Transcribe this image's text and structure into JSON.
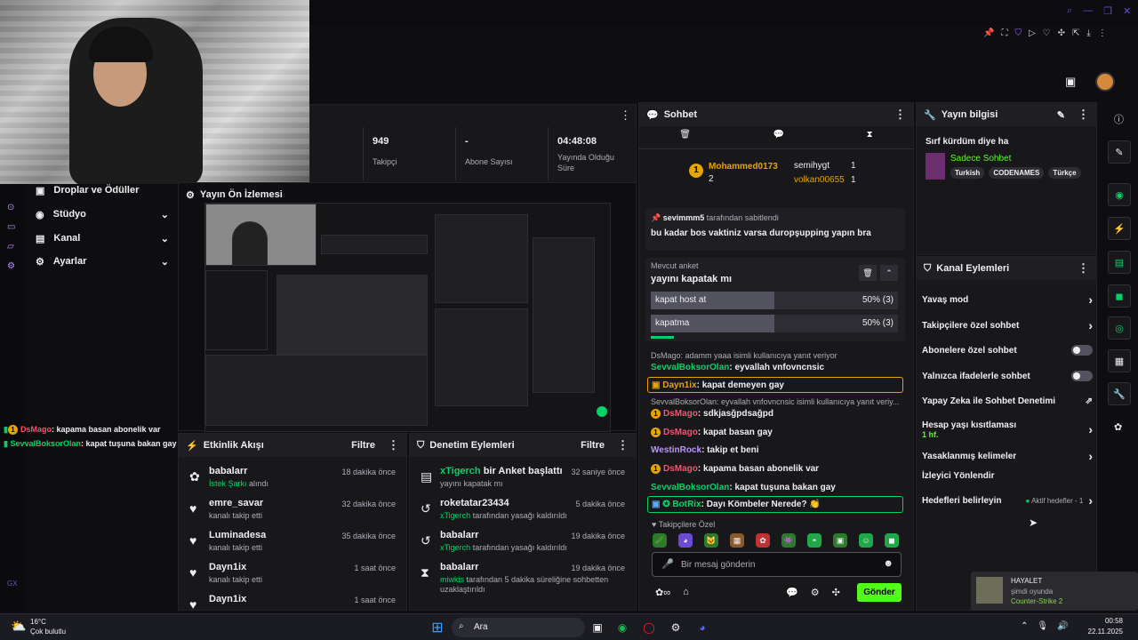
{
  "topbar": {
    "icons": [
      "search-icon",
      "minimize-icon",
      "maximize-icon",
      "close-icon"
    ]
  },
  "toolbar": {
    "icons": [
      "pin-icon",
      "crop-icon",
      "shield-icon",
      "play-icon",
      "heart-icon",
      "puzzle-icon",
      "share-icon",
      "download-icon",
      "settings-icon"
    ]
  },
  "stats": {
    "followers": "949",
    "followers_label": "Takipçi",
    "subs": "-",
    "subs_label": "Abone Sayısı",
    "uptime": "04:48:08",
    "uptime_label": "Yayında Olduğu Süre"
  },
  "sidebar": {
    "items": [
      {
        "label": "Droplar ve Ödüller"
      },
      {
        "label": "Stüdyo"
      },
      {
        "label": "Kanal"
      },
      {
        "label": "Ayarlar"
      }
    ],
    "gx": "GX"
  },
  "overlay_chat": [
    {
      "user": "DsMago",
      "text": ": kapama basan abonelik var"
    },
    {
      "user": "SevvalBoksorOlan",
      "text": ": kapat tuşuna bakan gay"
    }
  ],
  "preview": {
    "title": "Yayın Ön İzlemesi"
  },
  "activity": {
    "title": "Etkinlik Akışı",
    "filter": "Filtre",
    "rows": [
      {
        "name": "babalarr",
        "sub_hl": "İstek Şarkı",
        "sub": " alındı",
        "time": "18 dakika önce",
        "icon": "gift-icon"
      },
      {
        "name": "emre_savar",
        "sub": "kanalı takip etti",
        "time": "32 dakika önce",
        "icon": "heart-icon"
      },
      {
        "name": "Luminadesa",
        "sub": "kanalı takip etti",
        "time": "35 dakika önce",
        "icon": "heart-icon"
      },
      {
        "name": "Dayn1ix",
        "sub": "kanalı takip etti",
        "time": "1 saat önce",
        "icon": "heart-icon"
      },
      {
        "name": "Dayn1ix",
        "sub": "",
        "time": "1 saat önce",
        "icon": "heart-icon"
      }
    ]
  },
  "moderation": {
    "title": "Denetim Eylemleri",
    "filter": "Filtre",
    "rows": [
      {
        "name": "xTigerch",
        "name_tail": " bir Anket başlattı",
        "sub": "yayını kapatak mı",
        "time": "32 saniye önce"
      },
      {
        "name": "roketatar23434",
        "sub_hl": "xTigerch",
        "sub": " tarafından yasağı kaldırıldı",
        "time": "5 dakika önce"
      },
      {
        "name": "babalarr",
        "sub_hl": "xTigerch",
        "sub": " tarafından yasağı kaldırıldı",
        "time": "19 dakika önce"
      },
      {
        "name": "babalarr",
        "sub_hl": "miwkis",
        "sub": " tarafından 5 dakika süreliğine sohbetten uzaklaştırıldı",
        "time": "19 dakika önce"
      }
    ]
  },
  "chat": {
    "title": "Sohbet",
    "leaders": [
      {
        "rank": "1",
        "name": "Mohammed0173",
        "count": "2"
      },
      {
        "name": "semihygt",
        "count": "1"
      },
      {
        "name": "volkan00655",
        "count": "1"
      }
    ],
    "pinned_by_user": "sevimmm5",
    "pinned_by_label": " tarafından sabitlendi",
    "pinned_text": "bu kadar bos vaktiniz varsa duropşupping yapın bra",
    "poll_label": "Mevcut anket",
    "poll_title": "yayını kapatak mı",
    "poll_options": [
      {
        "label": "kapat host at",
        "pct": "50% (3)",
        "value": 50
      },
      {
        "label": "kapatma",
        "pct": "50% (3)",
        "value": 50
      }
    ],
    "messages": [
      {
        "reply": "DsMago: adamm yaaa isimli kullanıcıya yanıt veriyor"
      },
      {
        "user": "SevvalBoksorOlan",
        "text": ": eyvallah vnfovncnsic",
        "color": "#00d26a"
      },
      {
        "user": "Dayn1ix",
        "text": ": kapat demeyen gay",
        "color": "#e5a400",
        "hl": true
      },
      {
        "reply": "SevvalBoksorOlan: eyvallah vnfovncnsic isimli kullanıcıya yanıt veriy..."
      },
      {
        "user": "DsMago",
        "text": ": sdkjasğpdsağpd",
        "color": "#ff4d6d",
        "badge": true
      },
      {
        "user": "DsMago",
        "text": ": kapat basan gay",
        "color": "#ff4d6d",
        "badge": true
      },
      {
        "user": "WestinRock",
        "text": ": takip et beni",
        "color": "#bf94ff"
      },
      {
        "user": "DsMago",
        "text": ": kapama basan abonelik var",
        "color": "#ff4d6d",
        "badge": true
      },
      {
        "user": "SevvalBoksorOlan",
        "text": ": kapat tuşuna bakan gay",
        "color": "#00d26a"
      },
      {
        "user": "BotRix",
        "text": ": Dayı Kömbeler Nerede? 👏",
        "color": "#00d26a",
        "hl": true
      }
    ],
    "emote_label": "Takipçilere Özel",
    "input_placeholder": "Bir mesaj gönderin",
    "send_label": "Gönder"
  },
  "stream_info": {
    "title": "Yayın bilgisi",
    "stream_title": "Sırf kürdüm diye ha",
    "category": "Sadece Sohbet",
    "tags": [
      "Turkish",
      "CODENAMES",
      "Türkçe"
    ]
  },
  "channel_actions": {
    "title": "Kanal Eylemleri",
    "items": [
      {
        "label": "Yavaş mod",
        "type": "chev"
      },
      {
        "label": "Takipçilere özel sohbet",
        "type": "chev"
      },
      {
        "label": "Abonelere özel sohbet",
        "type": "toggle"
      },
      {
        "label": "Yalnızca ifadelerle sohbet",
        "type": "toggle"
      },
      {
        "label": "Yapay Zeka ile Sohbet Denetimi",
        "type": "ext"
      },
      {
        "label": "Hesap yaşı kısıtlaması",
        "sub": "1 hf.",
        "type": "chev"
      },
      {
        "label": "Yasaklanmış kelimeler",
        "type": "chev"
      },
      {
        "label": "İzleyici Yönlendir",
        "type": "none"
      },
      {
        "label": "Hedefleri belirleyin",
        "type": "chev",
        "extra": "Aktif hedefler - 1"
      }
    ]
  },
  "notification": {
    "title": "HAYALET",
    "status": "şimdi oyunda",
    "game": "Counter-Strike 2"
  },
  "taskbar": {
    "weather_temp": "16°C",
    "weather_desc": "Çok bulutlu",
    "search": "Ara",
    "time": "00:58",
    "date": "22.11.2025"
  }
}
